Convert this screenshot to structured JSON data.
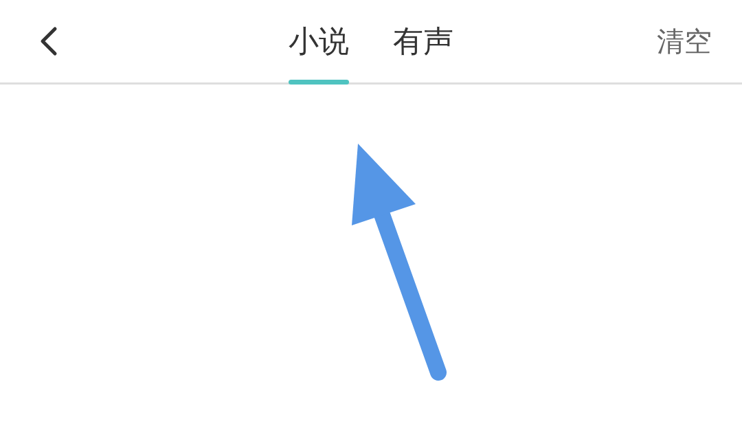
{
  "header": {
    "tabs": [
      {
        "label": "小说",
        "selected": true
      },
      {
        "label": "有声",
        "selected": false
      }
    ],
    "action": "清空"
  }
}
